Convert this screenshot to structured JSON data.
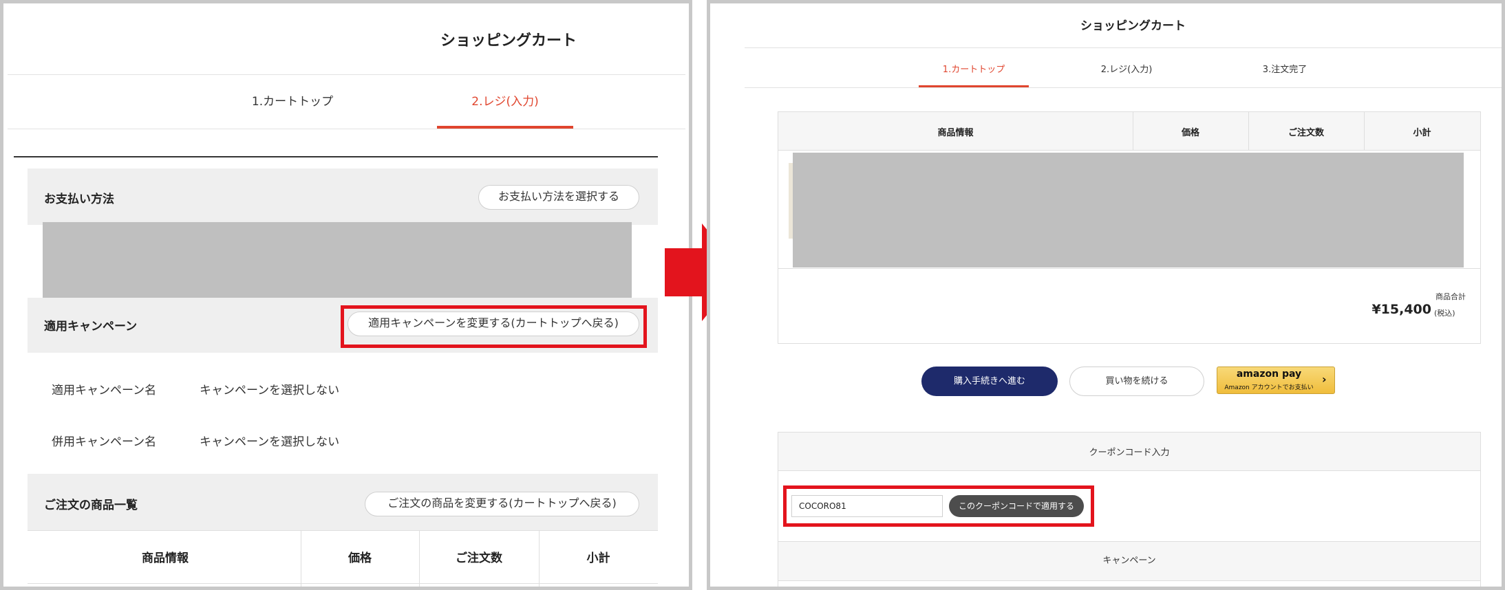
{
  "left": {
    "page_title": "ショッピングカート",
    "tabs": [
      {
        "label": "1.カートトップ",
        "active": false
      },
      {
        "label": "2.レジ(入力)",
        "active": true
      }
    ],
    "payment": {
      "label": "お支払い方法",
      "button": "お支払い方法を選択する"
    },
    "campaign": {
      "label": "適用キャンペーン",
      "button": "適用キャンペーンを変更する(カートトップへ戻る)",
      "rows": [
        {
          "name": "適用キャンペーン名",
          "value": "キャンペーンを選択しない"
        },
        {
          "name": "併用キャンペーン名",
          "value": "キャンペーンを選択しない"
        }
      ]
    },
    "order_items": {
      "label": "ご注文の商品一覧",
      "button": "ご注文の商品を変更する(カートトップへ戻る)",
      "columns": [
        "商品情報",
        "価格",
        "ご注文数",
        "小計"
      ]
    }
  },
  "right": {
    "page_title": "ショッピングカート",
    "tabs": [
      {
        "label": "1.カートトップ",
        "active": true
      },
      {
        "label": "2.レジ(入力)",
        "active": false
      },
      {
        "label": "3.注文完了",
        "active": false
      }
    ],
    "columns": [
      "商品情報",
      "価格",
      "ご注文数",
      "小計"
    ],
    "total": {
      "label": "商品合計",
      "amount": "¥15,400",
      "tax_note": "(税込)"
    },
    "buttons": {
      "checkout": "購入手続きへ進む",
      "continue": "買い物を続ける",
      "amazon_brand": "amazon pay",
      "amazon_sub": "Amazon アカウントでお支払い"
    },
    "coupon": {
      "heading": "クーポンコード入力",
      "input_value": "COCORO81",
      "apply_button": "このクーポンコードで適用する"
    },
    "campaign_heading": "キャンペーン"
  },
  "colors": {
    "accent": "#e0452e",
    "highlight": "#e3141d",
    "checkout_button": "#1e2a6b",
    "coupon_button": "#4d4d4d",
    "amazon_button": "#f3c449"
  }
}
